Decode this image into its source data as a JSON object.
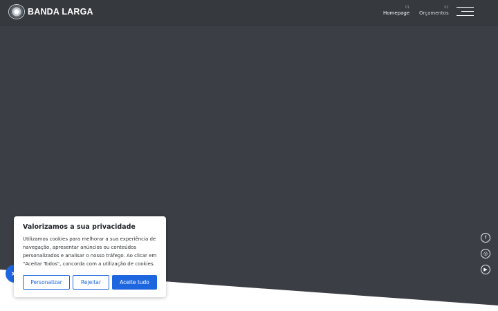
{
  "header": {
    "logo_text": "BANDA LARGA",
    "nav": [
      {
        "num": "01",
        "label": "Homepage"
      },
      {
        "num": "02",
        "label": "Orçamentos"
      }
    ]
  },
  "social": {
    "facebook": "f",
    "instagram": "◎",
    "youtube": "▶"
  },
  "accessibility": {
    "icon": "✱"
  },
  "cookie": {
    "title": "Valorizamos a sua privacidade",
    "text": "Utilizamos cookies para melhorar a sua experiência de navegação, apresentar anúncios ou conteúdos personalizados e analisar o nosso tráfego. Ao clicar em \"Aceitar Todos\", concorda com a utilização de cookies.",
    "buttons": {
      "customize": "Personalizar",
      "reject": "Rejeitar",
      "accept": "Aceite tudo"
    }
  },
  "colors": {
    "background": "#3b3e44",
    "accent": "#1e66e0"
  }
}
